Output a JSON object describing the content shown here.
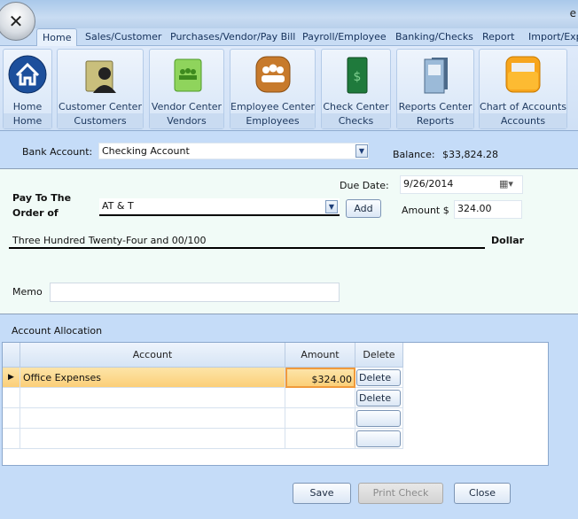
{
  "window": {
    "title_fragment": "e"
  },
  "app_menu": {
    "icon": "app-orb-icon",
    "glyph": "✕"
  },
  "tabs": [
    {
      "label": "Home",
      "active": true
    },
    {
      "label": "Sales/Customer"
    },
    {
      "label": "Purchases/Vendor/Pay Bill"
    },
    {
      "label": "Payroll/Employee"
    },
    {
      "label": "Banking/Checks"
    },
    {
      "label": "Report"
    },
    {
      "label": "Import/Exp"
    }
  ],
  "ribbon": [
    {
      "label": "Home",
      "group": "Home",
      "icon": "home-icon"
    },
    {
      "label": "Customer Center",
      "group": "Customers",
      "icon": "customer-folder-icon"
    },
    {
      "label": "Vendor Center",
      "group": "Vendors",
      "icon": "vendor-book-icon"
    },
    {
      "label": "Employee Center",
      "group": "Employees",
      "icon": "employees-icon"
    },
    {
      "label": "Check Center",
      "group": "Checks",
      "icon": "checkbook-icon"
    },
    {
      "label": "Reports Center",
      "group": "Reports",
      "icon": "reports-binder-icon"
    },
    {
      "label": "Chart of Accounts",
      "group": "Accounts",
      "icon": "accounts-folder-icon"
    }
  ],
  "bank": {
    "label": "Bank Account:",
    "value": "Checking Account",
    "balance_label": "Balance:",
    "balance": "$33,824.28"
  },
  "check": {
    "due_label": "Due Date:",
    "due_date": "9/26/2014",
    "payto_label1": "Pay To The",
    "payto_label2": "Order of",
    "payee": "AT & T",
    "add_label": "Add",
    "amount_label": "Amount $",
    "amount": "324.00",
    "amount_words": "Three Hundred Twenty-Four and 00/100",
    "dollar_label": "Dollar",
    "memo_label": "Memo",
    "memo": ""
  },
  "allocation": {
    "title": "Account Allocation",
    "columns": [
      "Account",
      "Amount",
      "Delete"
    ],
    "rows": [
      {
        "account": "Office Expenses",
        "amount": "$324.00",
        "delete": "Delete",
        "selected": true
      },
      {
        "account": "",
        "amount": "",
        "delete": "Delete"
      },
      {
        "account": "",
        "amount": "",
        "delete": ""
      },
      {
        "account": "",
        "amount": "",
        "delete": ""
      }
    ]
  },
  "footer": {
    "save": "Save",
    "print": "Print Check",
    "close": "Close"
  },
  "colors": {
    "selected_row": "#fbcf78",
    "panel": "#c5dcf8",
    "check_bg": "#f1fbf7"
  }
}
